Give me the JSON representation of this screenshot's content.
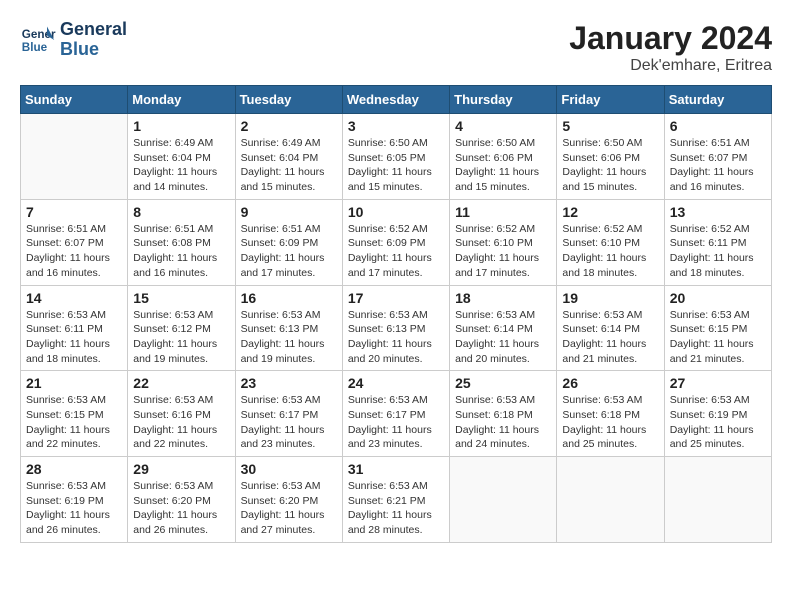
{
  "header": {
    "logo_line1": "General",
    "logo_line2": "Blue",
    "main_title": "January 2024",
    "subtitle": "Dek'emhare, Eritrea"
  },
  "calendar": {
    "days_of_week": [
      "Sunday",
      "Monday",
      "Tuesday",
      "Wednesday",
      "Thursday",
      "Friday",
      "Saturday"
    ],
    "weeks": [
      [
        {
          "day": "",
          "info": ""
        },
        {
          "day": "1",
          "info": "Sunrise: 6:49 AM\nSunset: 6:04 PM\nDaylight: 11 hours\nand 14 minutes."
        },
        {
          "day": "2",
          "info": "Sunrise: 6:49 AM\nSunset: 6:04 PM\nDaylight: 11 hours\nand 15 minutes."
        },
        {
          "day": "3",
          "info": "Sunrise: 6:50 AM\nSunset: 6:05 PM\nDaylight: 11 hours\nand 15 minutes."
        },
        {
          "day": "4",
          "info": "Sunrise: 6:50 AM\nSunset: 6:06 PM\nDaylight: 11 hours\nand 15 minutes."
        },
        {
          "day": "5",
          "info": "Sunrise: 6:50 AM\nSunset: 6:06 PM\nDaylight: 11 hours\nand 15 minutes."
        },
        {
          "day": "6",
          "info": "Sunrise: 6:51 AM\nSunset: 6:07 PM\nDaylight: 11 hours\nand 16 minutes."
        }
      ],
      [
        {
          "day": "7",
          "info": "Sunrise: 6:51 AM\nSunset: 6:07 PM\nDaylight: 11 hours\nand 16 minutes."
        },
        {
          "day": "8",
          "info": "Sunrise: 6:51 AM\nSunset: 6:08 PM\nDaylight: 11 hours\nand 16 minutes."
        },
        {
          "day": "9",
          "info": "Sunrise: 6:51 AM\nSunset: 6:09 PM\nDaylight: 11 hours\nand 17 minutes."
        },
        {
          "day": "10",
          "info": "Sunrise: 6:52 AM\nSunset: 6:09 PM\nDaylight: 11 hours\nand 17 minutes."
        },
        {
          "day": "11",
          "info": "Sunrise: 6:52 AM\nSunset: 6:10 PM\nDaylight: 11 hours\nand 17 minutes."
        },
        {
          "day": "12",
          "info": "Sunrise: 6:52 AM\nSunset: 6:10 PM\nDaylight: 11 hours\nand 18 minutes."
        },
        {
          "day": "13",
          "info": "Sunrise: 6:52 AM\nSunset: 6:11 PM\nDaylight: 11 hours\nand 18 minutes."
        }
      ],
      [
        {
          "day": "14",
          "info": "Sunrise: 6:53 AM\nSunset: 6:11 PM\nDaylight: 11 hours\nand 18 minutes."
        },
        {
          "day": "15",
          "info": "Sunrise: 6:53 AM\nSunset: 6:12 PM\nDaylight: 11 hours\nand 19 minutes."
        },
        {
          "day": "16",
          "info": "Sunrise: 6:53 AM\nSunset: 6:13 PM\nDaylight: 11 hours\nand 19 minutes."
        },
        {
          "day": "17",
          "info": "Sunrise: 6:53 AM\nSunset: 6:13 PM\nDaylight: 11 hours\nand 20 minutes."
        },
        {
          "day": "18",
          "info": "Sunrise: 6:53 AM\nSunset: 6:14 PM\nDaylight: 11 hours\nand 20 minutes."
        },
        {
          "day": "19",
          "info": "Sunrise: 6:53 AM\nSunset: 6:14 PM\nDaylight: 11 hours\nand 21 minutes."
        },
        {
          "day": "20",
          "info": "Sunrise: 6:53 AM\nSunset: 6:15 PM\nDaylight: 11 hours\nand 21 minutes."
        }
      ],
      [
        {
          "day": "21",
          "info": "Sunrise: 6:53 AM\nSunset: 6:15 PM\nDaylight: 11 hours\nand 22 minutes."
        },
        {
          "day": "22",
          "info": "Sunrise: 6:53 AM\nSunset: 6:16 PM\nDaylight: 11 hours\nand 22 minutes."
        },
        {
          "day": "23",
          "info": "Sunrise: 6:53 AM\nSunset: 6:17 PM\nDaylight: 11 hours\nand 23 minutes."
        },
        {
          "day": "24",
          "info": "Sunrise: 6:53 AM\nSunset: 6:17 PM\nDaylight: 11 hours\nand 23 minutes."
        },
        {
          "day": "25",
          "info": "Sunrise: 6:53 AM\nSunset: 6:18 PM\nDaylight: 11 hours\nand 24 minutes."
        },
        {
          "day": "26",
          "info": "Sunrise: 6:53 AM\nSunset: 6:18 PM\nDaylight: 11 hours\nand 25 minutes."
        },
        {
          "day": "27",
          "info": "Sunrise: 6:53 AM\nSunset: 6:19 PM\nDaylight: 11 hours\nand 25 minutes."
        }
      ],
      [
        {
          "day": "28",
          "info": "Sunrise: 6:53 AM\nSunset: 6:19 PM\nDaylight: 11 hours\nand 26 minutes."
        },
        {
          "day": "29",
          "info": "Sunrise: 6:53 AM\nSunset: 6:20 PM\nDaylight: 11 hours\nand 26 minutes."
        },
        {
          "day": "30",
          "info": "Sunrise: 6:53 AM\nSunset: 6:20 PM\nDaylight: 11 hours\nand 27 minutes."
        },
        {
          "day": "31",
          "info": "Sunrise: 6:53 AM\nSunset: 6:21 PM\nDaylight: 11 hours\nand 28 minutes."
        },
        {
          "day": "",
          "info": ""
        },
        {
          "day": "",
          "info": ""
        },
        {
          "day": "",
          "info": ""
        }
      ]
    ]
  }
}
